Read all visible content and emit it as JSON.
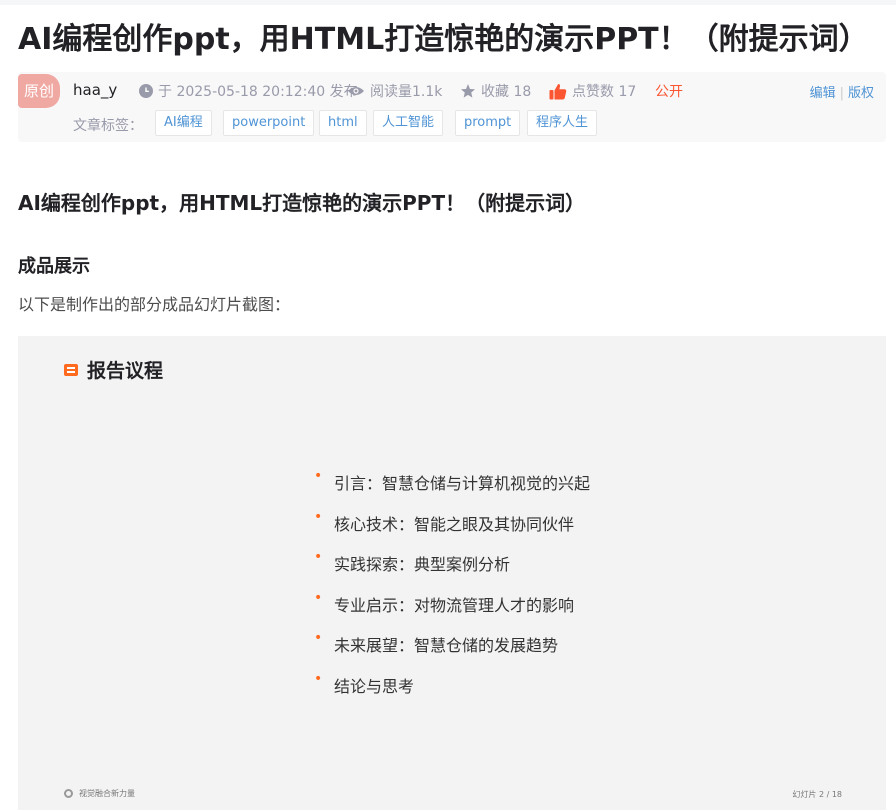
{
  "article": {
    "title": "AI编程创作ppt，用HTML打造惊艳的演示PPT！（附提示词）",
    "badge": "原创",
    "author": "haa_y",
    "published": "于 2025-05-18 20:12:40 发布",
    "reads": "阅读量1.1k",
    "favorites": "收藏 18",
    "likes": "点赞数 17",
    "visibility": "公开",
    "edit_label": "编辑",
    "copyright_label": "版权",
    "tags_label": "文章标签：",
    "tags": [
      "AI编程",
      "powerpoint",
      "html",
      "人工智能",
      "prompt",
      "程序人生"
    ]
  },
  "content": {
    "subtitle": "AI编程创作ppt，用HTML打造惊艳的演示PPT！（附提示词）",
    "section_heading": "成品展示",
    "intro": "以下是制作出的部分成品幻灯片截图："
  },
  "slide": {
    "title": "报告议程",
    "agenda": [
      "引言：智慧仓储与计算机视觉的兴起",
      "核心技术：智能之眼及其协同伙伴",
      "实践探索：典型案例分析",
      "专业启示：对物流管理人才的影响",
      "未来展望：智慧仓储的发展趋势",
      "结论与思考"
    ],
    "footer_left": "视觉融合新力量",
    "footer_right": "幻灯片 2 / 18"
  },
  "colors": {
    "accent": "#fc5531",
    "link": "#5094d5",
    "badge": "#f0a8a3",
    "bullet": "#ff6a1f"
  },
  "icons": {
    "published": "clock-icon",
    "reads": "eye-icon",
    "favorites": "star-icon",
    "likes": "thumbs-up-icon",
    "slide_title": "list-icon"
  }
}
